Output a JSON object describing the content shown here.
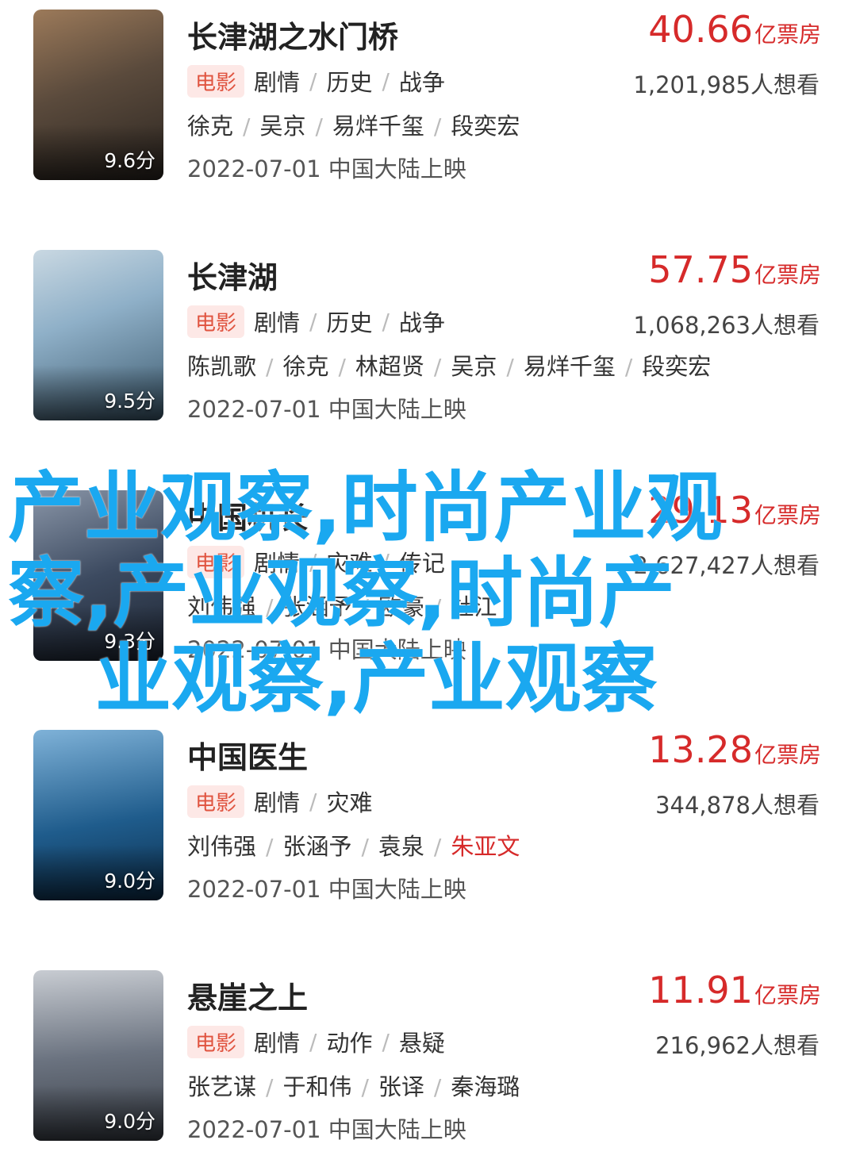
{
  "movies": [
    {
      "title": "长津湖之水门桥",
      "box_num": "40.66",
      "box_unit": "亿票房",
      "badge": "电影",
      "genres": [
        "剧情",
        "历史",
        "战争"
      ],
      "wants": "1,201,985人想看",
      "cast": [
        "徐克",
        "吴京",
        "易烊千玺",
        "段奕宏"
      ],
      "release": "2022-07-01 中国大陆上映",
      "score": "9.6分",
      "poster_colors": [
        "#5a4a3c",
        "#a07a58",
        "#2b2520"
      ]
    },
    {
      "title": "长津湖",
      "box_num": "57.75",
      "box_unit": "亿票房",
      "badge": "电影",
      "genres": [
        "剧情",
        "历史",
        "战争"
      ],
      "wants": "1,068,263人想看",
      "cast": [
        "陈凯歌",
        "徐克",
        "林超贤",
        "吴京",
        "易烊千玺",
        "段奕宏"
      ],
      "release": "2022-07-01 中国大陆上映",
      "score": "9.5分",
      "poster_colors": [
        "#8fb0c8",
        "#3d5a6e",
        "#c9d8e2"
      ]
    },
    {
      "title": "中国机长",
      "box_num": "29.13",
      "box_unit": "亿票房",
      "badge": "电影",
      "genres": [
        "剧情",
        "灾难",
        "传记"
      ],
      "wants": "2,627,427人想看",
      "cast": [
        "刘伟强",
        "张涵予",
        "欧豪",
        "杜江"
      ],
      "release": "2022-07-01 中国大陆上映",
      "score": "9.3分",
      "poster_colors": [
        "#3c4a60",
        "#8a96a8",
        "#1e2633"
      ]
    },
    {
      "title": "中国医生",
      "box_num": "13.28",
      "box_unit": "亿票房",
      "badge": "电影",
      "genres": [
        "剧情",
        "灾难"
      ],
      "wants": "344,878人想看",
      "cast": [
        "刘伟强",
        "张涵予",
        "袁泉",
        "朱亚文"
      ],
      "cast_highlight_index": 3,
      "release": "2022-07-01 中国大陆上映",
      "score": "9.0分",
      "poster_colors": [
        "#1f5c8c",
        "#7fb2d8",
        "#0d2f4d"
      ]
    },
    {
      "title": "悬崖之上",
      "box_num": "11.91",
      "box_unit": "亿票房",
      "badge": "电影",
      "genres": [
        "剧情",
        "动作",
        "悬疑"
      ],
      "wants": "216,962人想看",
      "cast": [
        "张艺谋",
        "于和伟",
        "张译",
        "秦海璐"
      ],
      "release": "2022-07-01 中国大陆上映",
      "score": "9.0分",
      "poster_colors": [
        "#6b7380",
        "#c8ccd2",
        "#3a3f47"
      ]
    }
  ],
  "watermark": [
    "产业观察,时尚产业观",
    "察,产业观察,时尚产",
    "业观察,产业观察"
  ],
  "colors": {
    "accent": "#d62a2a",
    "badge_bg": "#fde8e6",
    "watermark": "#1aa8f0"
  }
}
